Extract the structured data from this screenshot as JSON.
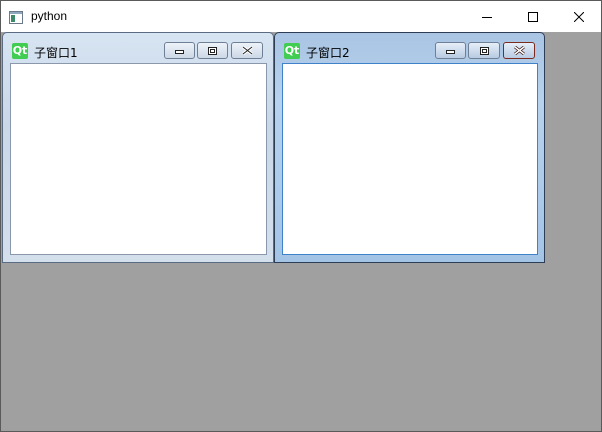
{
  "app": {
    "title": "python",
    "icon": "window-app-icon",
    "controls": [
      "minimize-icon",
      "maximize-icon",
      "close-icon"
    ]
  },
  "subwindows": [
    {
      "title": "子窗口1",
      "icon_text": "Qt",
      "state": "inactive",
      "controls": [
        "minimize-icon",
        "restore-icon",
        "close-icon"
      ]
    },
    {
      "title": "子窗口2",
      "icon_text": "Qt",
      "state": "active",
      "controls": [
        "minimize-icon",
        "restore-icon",
        "close-icon"
      ]
    }
  ],
  "colors": {
    "mdi_background": "#a0a0a0",
    "qt_green": "#41cd52",
    "active_close": "#c24f33"
  }
}
